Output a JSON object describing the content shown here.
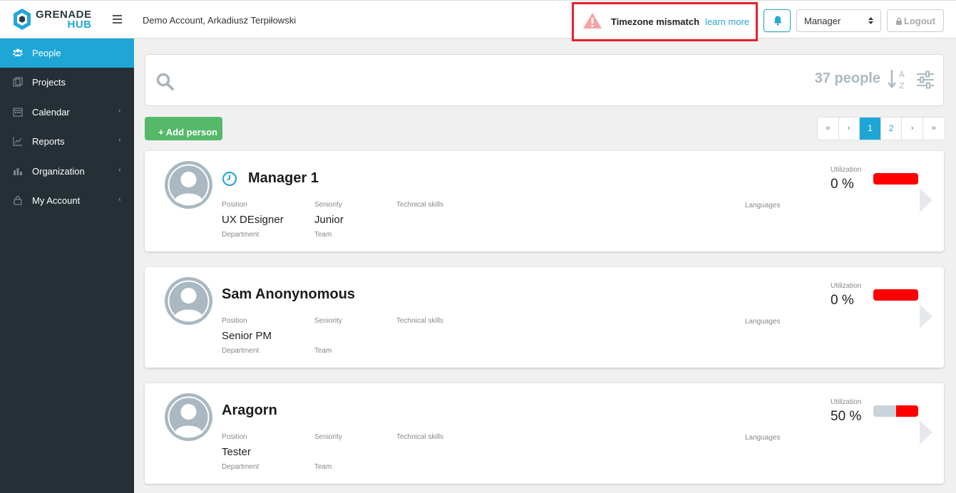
{
  "header": {
    "logo_line1": "GRENADE",
    "logo_line2": "HUB",
    "account": "Demo Account, Arkadiusz Terpiłowski",
    "timezone_warning": "Timezone mismatch",
    "timezone_link": "learn more",
    "role_selected": "Manager",
    "logout_label": "Logout"
  },
  "sidebar": {
    "items": [
      {
        "label": "People",
        "icon": "users-icon",
        "active": true
      },
      {
        "label": "Projects",
        "icon": "projects-icon"
      },
      {
        "label": "Calendar",
        "icon": "calendar-icon",
        "expandable": true
      },
      {
        "label": "Reports",
        "icon": "chart-icon",
        "expandable": true
      },
      {
        "label": "Organization",
        "icon": "organization-icon",
        "expandable": true
      },
      {
        "label": "My Account",
        "icon": "lock-icon",
        "expandable": true
      }
    ]
  },
  "search": {
    "count": "37 people"
  },
  "actions": {
    "add_person": "Add person"
  },
  "pagination": {
    "first": "«",
    "prev": "‹",
    "pages": [
      "1",
      "2"
    ],
    "current": "1",
    "next": "›",
    "last": "»"
  },
  "field_labels": {
    "position": "Position",
    "seniority": "Seniority",
    "technical_skills": "Technical skills",
    "languages": "Languages",
    "department": "Department",
    "team": "Team",
    "utilization": "Utilization"
  },
  "people": [
    {
      "name": "Manager 1",
      "position": "UX DEsigner",
      "seniority": "Junior",
      "utilization": "0 %",
      "utilization_value": 0,
      "has_clock": true
    },
    {
      "name": "Sam Anonynomous",
      "position": "Senior PM",
      "seniority": "",
      "utilization": "0 %",
      "utilization_value": 0,
      "has_clock": false
    },
    {
      "name": "Aragorn",
      "position": "Tester",
      "seniority": "",
      "utilization": "50 %",
      "utilization_value": 50,
      "has_clock": false
    }
  ],
  "colors": {
    "accent": "#1ea6d6",
    "sidebar_bg": "#253036",
    "add_button": "#55b96a",
    "alert_border": "#e8202a",
    "utilization_bar": "#ff0000"
  }
}
